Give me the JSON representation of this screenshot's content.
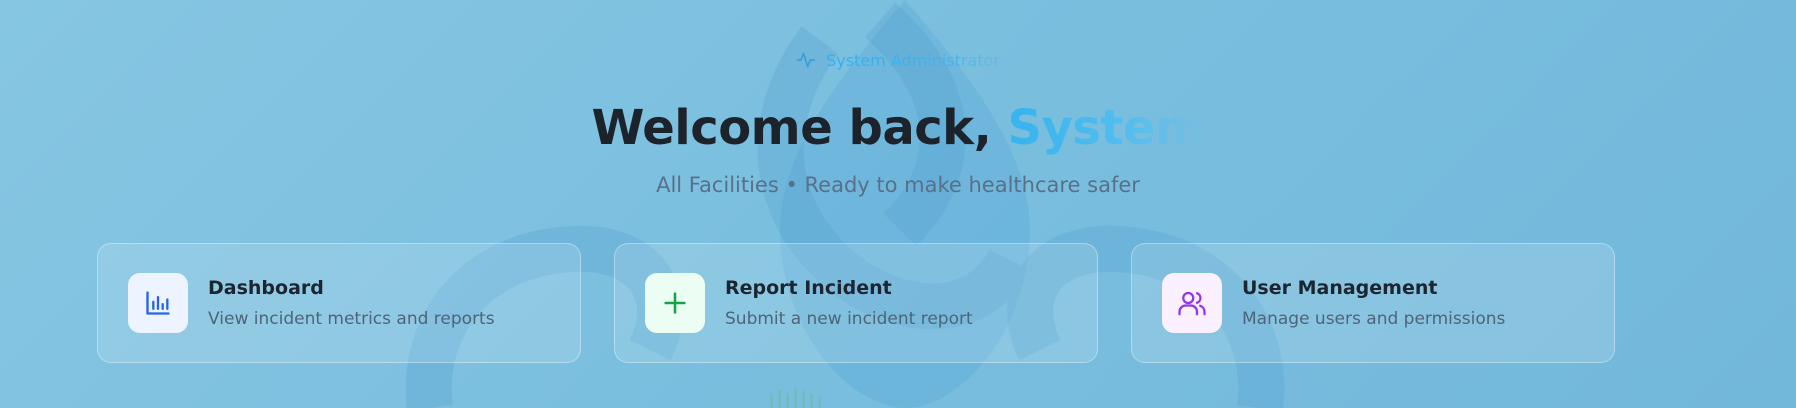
{
  "header": {
    "role": "System Administrator",
    "welcome_prefix": "Welcome back, ",
    "welcome_name": "System",
    "subtitle": "All Facilities • Ready to make healthcare safer"
  },
  "cards": [
    {
      "title": "Dashboard",
      "description": "View incident metrics and reports",
      "icon": "bar-chart-icon",
      "icon_color": "#2563eb",
      "icon_bg": "#eef4ff"
    },
    {
      "title": "Report Incident",
      "description": "Submit a new incident report",
      "icon": "plus-icon",
      "icon_color": "#16a34a",
      "icon_bg": "#ecfdf3"
    },
    {
      "title": "User Management",
      "description": "Manage users and permissions",
      "icon": "users-icon",
      "icon_color": "#9333ea",
      "icon_bg": "#faf0ff"
    }
  ],
  "colors": {
    "accent": "#38b2ea",
    "background": "#7bbfdf"
  }
}
